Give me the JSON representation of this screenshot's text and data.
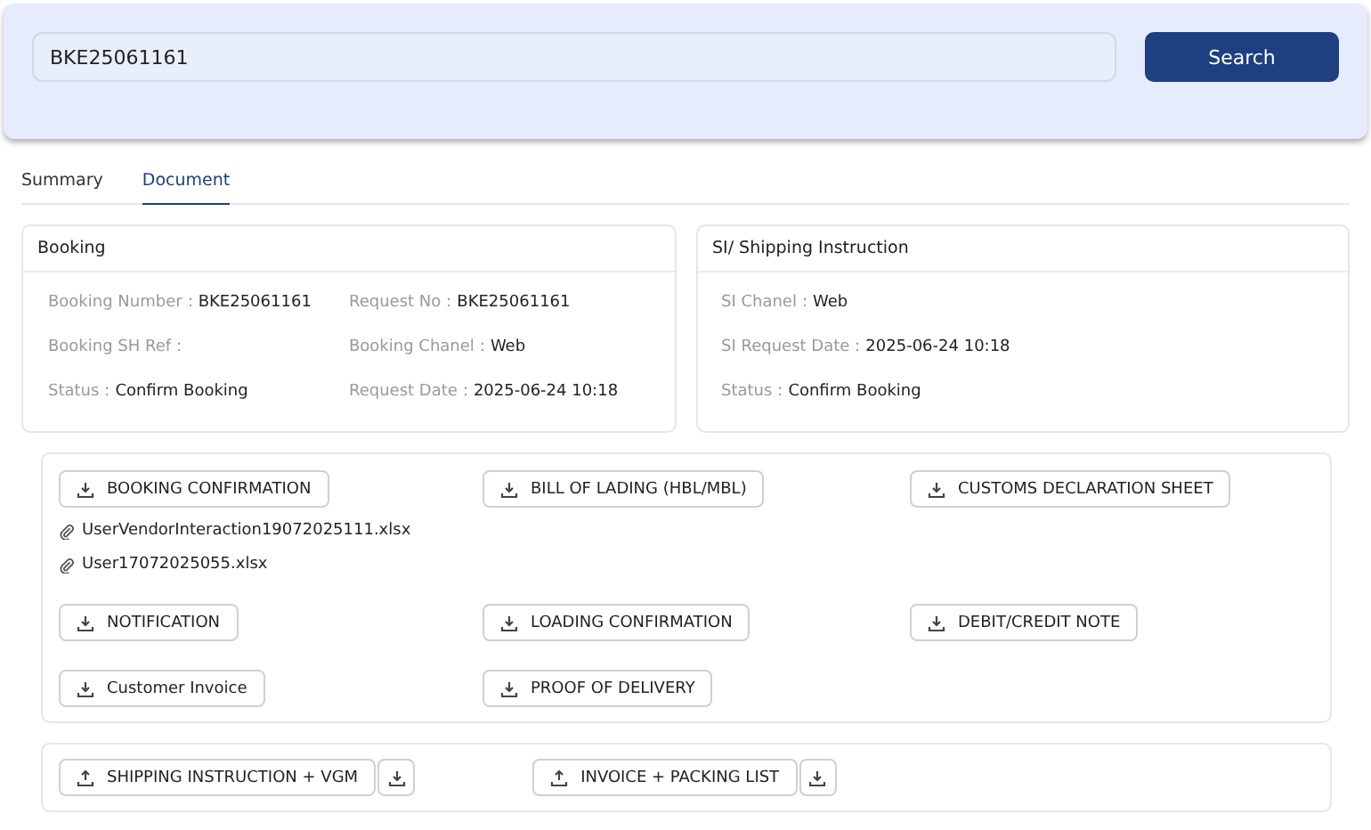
{
  "search": {
    "value": "BKE25061161",
    "button": "Search"
  },
  "tabs": [
    {
      "label": "Summary",
      "selected": false
    },
    {
      "label": "Document",
      "selected": true
    }
  ],
  "cards": [
    {
      "title": "Booking",
      "fields": [
        {
          "label": "Booking Number：",
          "value": "BKE25061161"
        },
        {
          "label": "Request No：",
          "value": "BKE25061161"
        },
        {
          "label": "Booking SH Ref："
        },
        {
          "label": "Booking Chanel：",
          "value": "Web"
        },
        {
          "label": "Status：",
          "value": "Confirm Booking"
        },
        {
          "label": "Request Date：",
          "value": "2025-06-24 10:18"
        }
      ]
    },
    {
      "title": "SI/ Shipping Instruction",
      "fields": [
        {
          "label": "SI Chanel：",
          "value": "Web"
        },
        {
          "label": "SI Request Date：",
          "value": "2025-06-24 10:18"
        },
        {
          "label": "Status：",
          "value": "Confirm Booking"
        }
      ]
    }
  ],
  "documents": [
    {
      "label": "BOOKING CONFIRMATION",
      "kind": "download",
      "files": [
        "UserVendorInteraction19072025111.xlsx",
        "User17072025055.xlsx"
      ]
    },
    {
      "label": "BILL OF LADING (HBL/MBL)",
      "kind": "download"
    },
    {
      "label": "CUSTOMS DECLARATION SHEET",
      "kind": "download"
    },
    {
      "label": "NOTIFICATION",
      "kind": "download"
    },
    {
      "label": "LOADING CONFIRMATION",
      "kind": "download"
    },
    {
      "label": "DEBIT/CREDIT NOTE",
      "kind": "download"
    },
    {
      "label": "Customer Invoice",
      "kind": "download"
    },
    {
      "label": "PROOF OF DELIVERY",
      "kind": "download"
    }
  ],
  "uploads": [
    {
      "label": "SHIPPING INSTRUCTION + VGM",
      "kind": "upload"
    },
    {
      "label": "INVOICE + PACKING LIST",
      "kind": "upload"
    }
  ]
}
